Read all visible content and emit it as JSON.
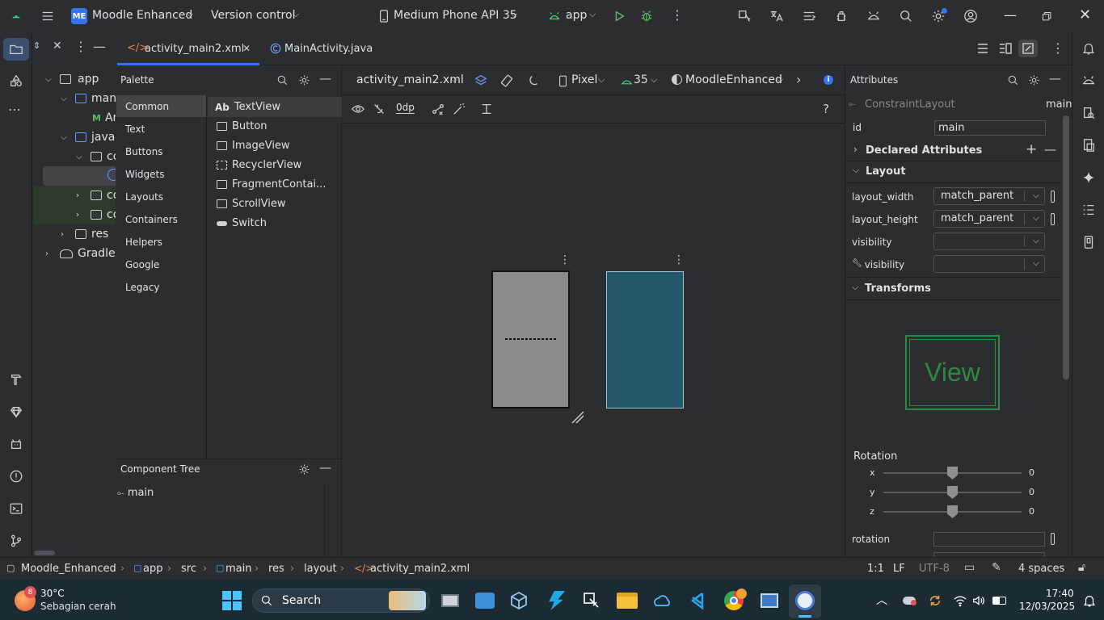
{
  "titlebar": {
    "project_badge": "ME",
    "project_name": "Moodle Enhanced",
    "version_control": "Version control",
    "device": "Medium Phone API 35",
    "run_config": "app"
  },
  "editor_tabs": [
    {
      "label": "activity_main2.xml",
      "active": true
    },
    {
      "label": "MainActivity.java",
      "active": false
    }
  ],
  "project_tree": {
    "items": [
      "app",
      "manif",
      "Ar",
      "java",
      "co",
      "co",
      "co",
      "res",
      "Gradle S"
    ]
  },
  "palette": {
    "title": "Palette",
    "categories": [
      "Common",
      "Text",
      "Buttons",
      "Widgets",
      "Layouts",
      "Containers",
      "Helpers",
      "Google",
      "Legacy"
    ],
    "items": [
      {
        "prefix": "Ab",
        "label": "TextView"
      },
      {
        "label": "Button"
      },
      {
        "label": "ImageView"
      },
      {
        "label": "RecyclerView"
      },
      {
        "label": "FragmentContai..."
      },
      {
        "label": "ScrollView"
      },
      {
        "label": "Switch"
      }
    ]
  },
  "component_tree": {
    "title": "Component Tree",
    "root": "main"
  },
  "design_toolbar": {
    "file": "activity_main2.xml",
    "device": "Pixel",
    "api": "35",
    "theme": "MoodleEnhanced",
    "margin": "0dp"
  },
  "attributes": {
    "title": "Attributes",
    "class_name": "ConstraintLayout",
    "id_value_right": "main",
    "id_label": "id",
    "id_value": "main",
    "declared": "Declared Attributes",
    "layout_section": "Layout",
    "layout_width_label": "layout_width",
    "layout_width": "match_parent",
    "layout_height_label": "layout_height",
    "layout_height": "match_parent",
    "visibility_label": "visibility",
    "tools_visibility_label": "visibility",
    "transforms": "Transforms",
    "view_preview": "View",
    "rotation_title": "Rotation",
    "rot_x_label": "x",
    "rot_x": "0",
    "rot_y_label": "y",
    "rot_y": "0",
    "rot_z_label": "z",
    "rot_z": "0",
    "rotation_label": "rotation"
  },
  "breadcrumb": [
    "Moodle_Enhanced",
    "app",
    "src",
    "main",
    "res",
    "layout",
    "activity_main2.xml"
  ],
  "statusbar": {
    "position": "1:1",
    "line_sep": "LF",
    "encoding": "UTF-8",
    "indent": "4 spaces"
  },
  "taskbar": {
    "weather_temp": "30°C",
    "weather_desc": "Sebagian cerah",
    "weather_badge": "8",
    "search": "Search",
    "time": "17:40",
    "date": "12/03/2025"
  },
  "colors": {
    "accent": "#3574f0",
    "teal_screen": "#23576b",
    "gray_screen": "#8a8a8a",
    "view_green": "#3fb950"
  }
}
